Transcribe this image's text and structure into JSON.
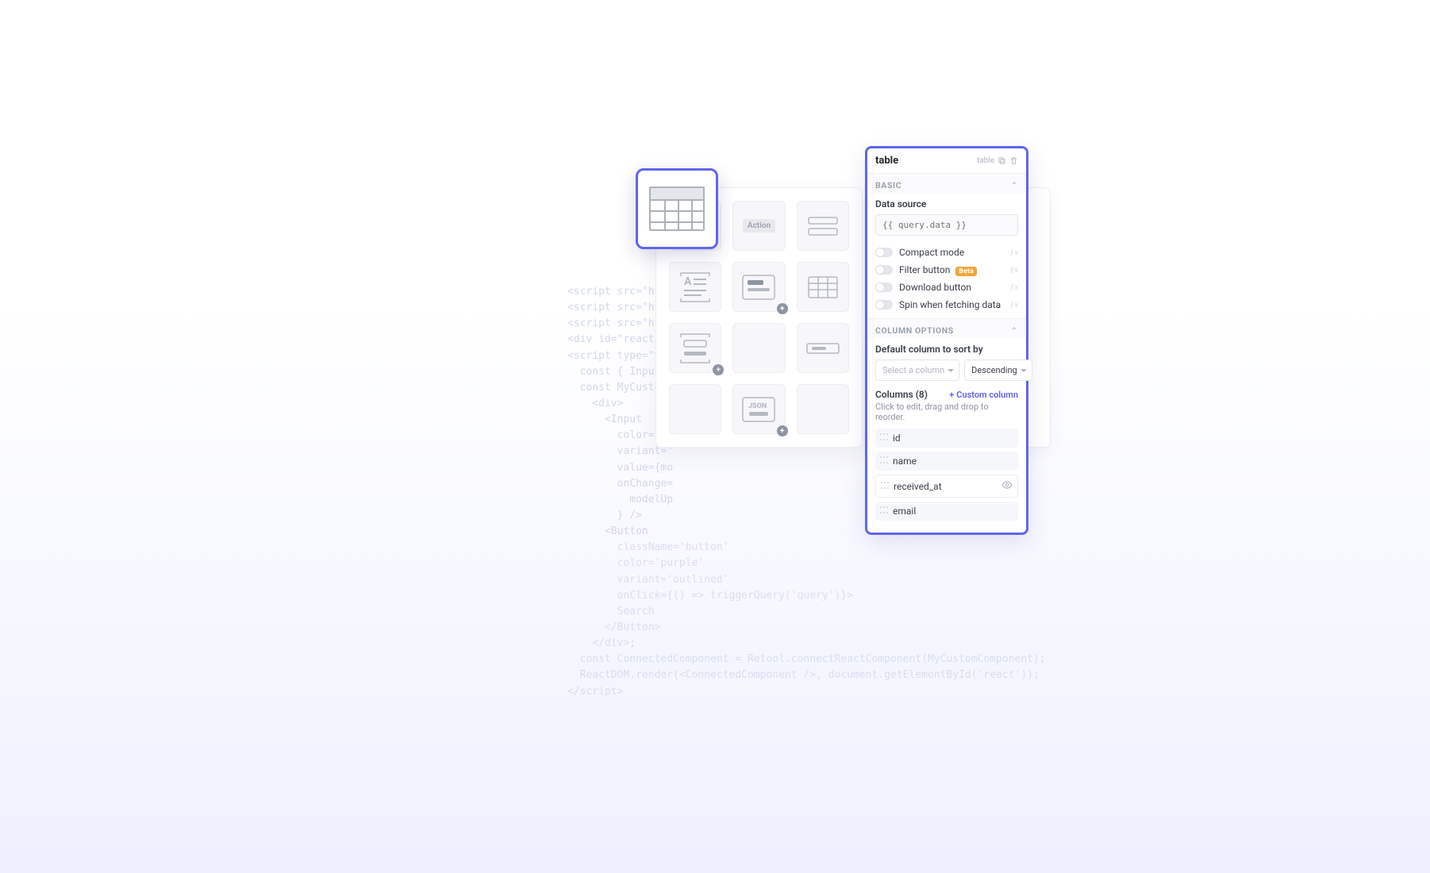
{
  "bg_code_lines": [
    "<script src=\"https:",
    "<script src=\"https:",
    "<script src=\"https:",
    "<div id=\"react\"></",
    "<script type=\"text/",
    "  const { Input, Bu",
    "  const MyCustomCom",
    "    <div>",
    "      <Input",
    "        color=\"pr",
    "        variant=\"",
    "        value={mo",
    "        onChange=",
    "          modelUp",
    "        } />",
    "      <Button",
    "        className='button'",
    "        color='purple'",
    "        variant='outlined'",
    "        onClick={() => triggerQuery('query')}>",
    "        Search",
    "      </Button>",
    "    </div>;",
    "  const ConnectedComponent = Retool.connectReactComponent(MyCustomComponent);",
    "  ReactDOM.render(<ConnectedComponent />, document.getElementById('react'));",
    "</script>"
  ],
  "gallery": {
    "action_label": "Action",
    "json_label": "JSON"
  },
  "panel": {
    "title": "table",
    "type_label": "table",
    "sections": {
      "basic_title": "BASIC",
      "column_options_title": "COLUMN OPTIONS"
    },
    "data_source": {
      "label": "Data source",
      "placeholder": "{{ query.data }}"
    },
    "toggles": {
      "compact_mode": "Compact mode",
      "filter_button": "Filter button",
      "filter_badge": "Beta",
      "download_button": "Download button",
      "spin_fetching": "Spin when fetching data"
    },
    "sort": {
      "label": "Default column to sort by",
      "column_placeholder": "Select a column",
      "direction": "Descending"
    },
    "columns": {
      "header": "Columns (8)",
      "add_label": "Custom column",
      "hint": "Click to edit, drag and drop to reorder.",
      "items": [
        {
          "name": "id",
          "selected": false
        },
        {
          "name": "name",
          "selected": false
        },
        {
          "name": "received_at",
          "selected": true
        },
        {
          "name": "email",
          "selected": false
        }
      ]
    }
  }
}
